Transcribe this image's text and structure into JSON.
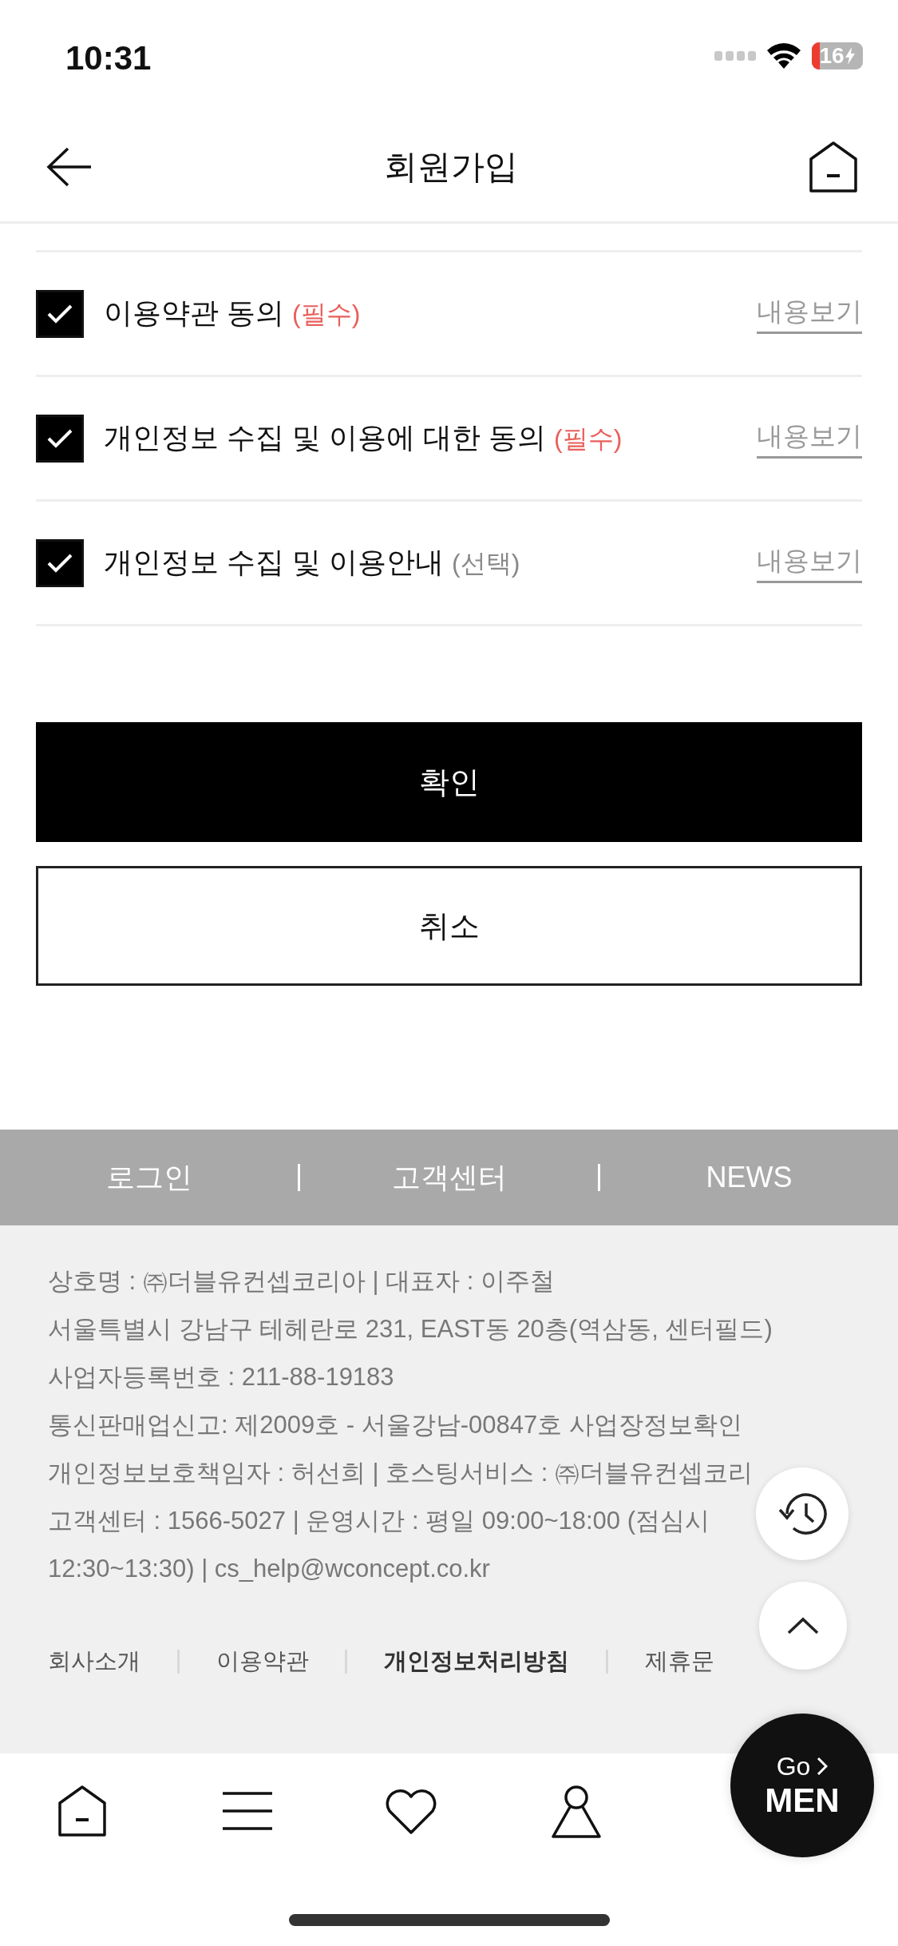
{
  "status_bar": {
    "time": "10:31",
    "battery": "16"
  },
  "header": {
    "title": "회원가입"
  },
  "agreements": [
    {
      "label": "이용약관 동의",
      "tag": "(필수)",
      "required": true,
      "checked": true,
      "link": "내용보기"
    },
    {
      "label": "개인정보 수집 및 이용에 대한 동의",
      "tag": "(필수)",
      "required": true,
      "checked": true,
      "link": "내용보기"
    },
    {
      "label": "개인정보 수집 및 이용안내",
      "tag": "(선택)",
      "required": false,
      "checked": true,
      "link": "내용보기"
    }
  ],
  "buttons": [
    {
      "label": "확인",
      "kind": "primary"
    },
    {
      "label": "취소",
      "kind": "secondary"
    }
  ],
  "footer_menu": [
    "로그인",
    "고객센터",
    "NEWS"
  ],
  "company_info": [
    "상호명 : ㈜더블유컨셉코리아 | 대표자 : 이주철",
    "서울특별시 강남구 테헤란로 231, EAST동 20층(역삼동, 센터필드)",
    "사업자등록번호 : 211-88-19183",
    "통신판매업신고: 제2009호 - 서울강남-00847호 사업장정보확인",
    "개인정보보호책임자 : 허선희 | 호스팅서비스 : ㈜더블유컨셉코리",
    "고객센터 : 1566-5027 | 운영시간 : 평일 09:00~18:00 (점심시",
    "12:30~13:30) | cs_help@wconcept.co.kr"
  ],
  "footer_links": [
    {
      "label": "회사소개",
      "bold": false
    },
    {
      "label": "이용약관",
      "bold": false
    },
    {
      "label": "개인정보처리방침",
      "bold": true
    },
    {
      "label": "제휴문",
      "bold": false
    }
  ],
  "go_button": {
    "top": "Go",
    "bottom": "MEN"
  }
}
